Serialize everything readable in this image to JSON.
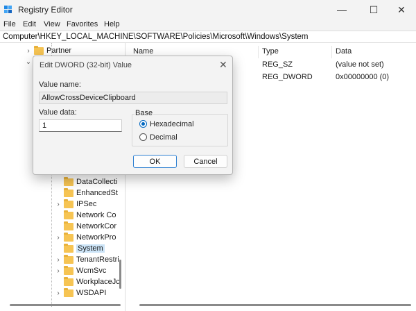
{
  "window": {
    "title": "Registry Editor",
    "controls": {
      "minimize": "—",
      "maximize": "☐",
      "close": "✕"
    }
  },
  "menu": [
    "File",
    "Edit",
    "View",
    "Favorites",
    "Help"
  ],
  "address": "Computer\\HKEY_LOCAL_MACHINE\\SOFTWARE\\Policies\\Microsoft\\Windows\\System",
  "tree": {
    "top_item": {
      "label": "Partner",
      "expanded": false
    },
    "items": [
      {
        "label": "DataCollecti",
        "has_children": false,
        "selected": false
      },
      {
        "label": "EnhancedSt",
        "has_children": false,
        "selected": false
      },
      {
        "label": "IPSec",
        "has_children": true,
        "selected": false
      },
      {
        "label": "Network Co",
        "has_children": false,
        "selected": false
      },
      {
        "label": "NetworkCor",
        "has_children": false,
        "selected": false
      },
      {
        "label": "NetworkPro",
        "has_children": true,
        "selected": false
      },
      {
        "label": "System",
        "has_children": false,
        "selected": true
      },
      {
        "label": "TenantRestri",
        "has_children": true,
        "selected": false
      },
      {
        "label": "WcmSvc",
        "has_children": true,
        "selected": false
      },
      {
        "label": "WorkplaceJc",
        "has_children": false,
        "selected": false
      },
      {
        "label": "WSDAPI",
        "has_children": true,
        "selected": false
      }
    ]
  },
  "values_table": {
    "headers": {
      "name": "Name",
      "type": "Type",
      "data": "Data"
    },
    "rows": [
      {
        "type": "REG_SZ",
        "data": "(value not set)"
      },
      {
        "type": "REG_DWORD",
        "data": "0x00000000 (0)"
      }
    ]
  },
  "dialog": {
    "title": "Edit DWORD (32-bit) Value",
    "close_icon": "✕",
    "value_name_label": "Value name:",
    "value_name": "AllowCrossDeviceClipboard",
    "value_data_label": "Value data:",
    "value_data": "1",
    "base_label": "Base",
    "base_options": [
      "Hexadecimal",
      "Decimal"
    ],
    "base_selected": "Hexadecimal",
    "ok_label": "OK",
    "cancel_label": "Cancel"
  },
  "colors": {
    "accent": "#0067c0",
    "selection": "#cce4f7",
    "folder": "#f6c453",
    "chrome": "#f3f3f3"
  }
}
